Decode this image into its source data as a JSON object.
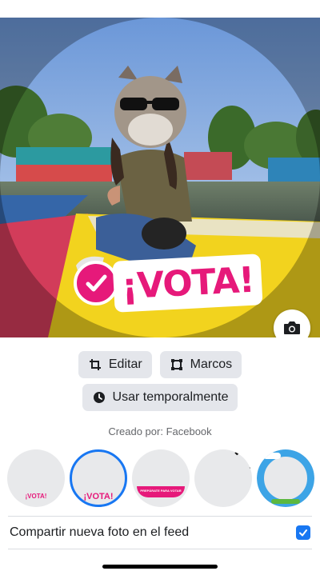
{
  "photo": {
    "badge_text": "¡VOTA!"
  },
  "actions": {
    "edit_label": "Editar",
    "frames_label": "Marcos",
    "temporary_label": "Usar temporalmente"
  },
  "created_by": "Creado por: Facebook",
  "frames": [
    {
      "name": "vota-small",
      "mini_text": "¡VOTA!",
      "selected": false
    },
    {
      "name": "vota-selected",
      "mini_text": "¡VOTA!",
      "selected": true
    },
    {
      "name": "preparate-para-votar",
      "mini_text": "PREPÁRATE PARA VOTAR",
      "selected": false
    },
    {
      "name": "black-corner",
      "mini_text": "",
      "selected": false
    },
    {
      "name": "sky-clouds",
      "mini_text": "",
      "selected": false
    }
  ],
  "share": {
    "label": "Compartir nueva foto en el feed",
    "checked": true
  },
  "colors": {
    "accent": "#1877f2",
    "badge_pink": "#e6197a",
    "button_bg": "#e4e6eb"
  },
  "icons": {
    "camera": "camera-icon",
    "edit": "crop-icon",
    "frames": "frame-icon",
    "temporary": "clock-icon",
    "checkbox": "check-icon"
  }
}
